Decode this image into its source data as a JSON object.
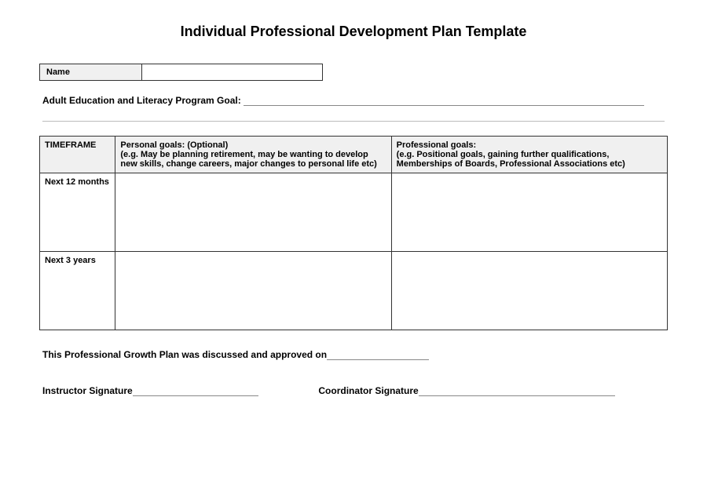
{
  "title": "Individual Professional Development Plan Template",
  "name_field": {
    "label": "Name",
    "value": ""
  },
  "program_goal": {
    "label": "Adult Education and Literacy Program Goal: ",
    "value": ""
  },
  "table": {
    "headers": {
      "timeframe": "TIMEFRAME",
      "personal_title": "Personal goals: (Optional)",
      "personal_sub": "(e.g. May be planning retirement, may be wanting to develop new skills, change careers, major changes to personal life etc)",
      "professional_title": "Professional goals:",
      "professional_sub": "(e.g. Positional goals, gaining further qualifications, Memberships of Boards, Professional Associations etc)"
    },
    "rows": [
      {
        "timeframe": "Next 12 months",
        "personal": "",
        "professional": ""
      },
      {
        "timeframe": "Next 3 years",
        "personal": "",
        "professional": ""
      }
    ]
  },
  "approval": {
    "text": "This Professional Growth Plan was discussed and approved on",
    "date": ""
  },
  "signatures": {
    "instructor_label": "Instructor Signature",
    "instructor_value": "",
    "coordinator_label": "Coordinator Signature",
    "coordinator_value": ""
  }
}
